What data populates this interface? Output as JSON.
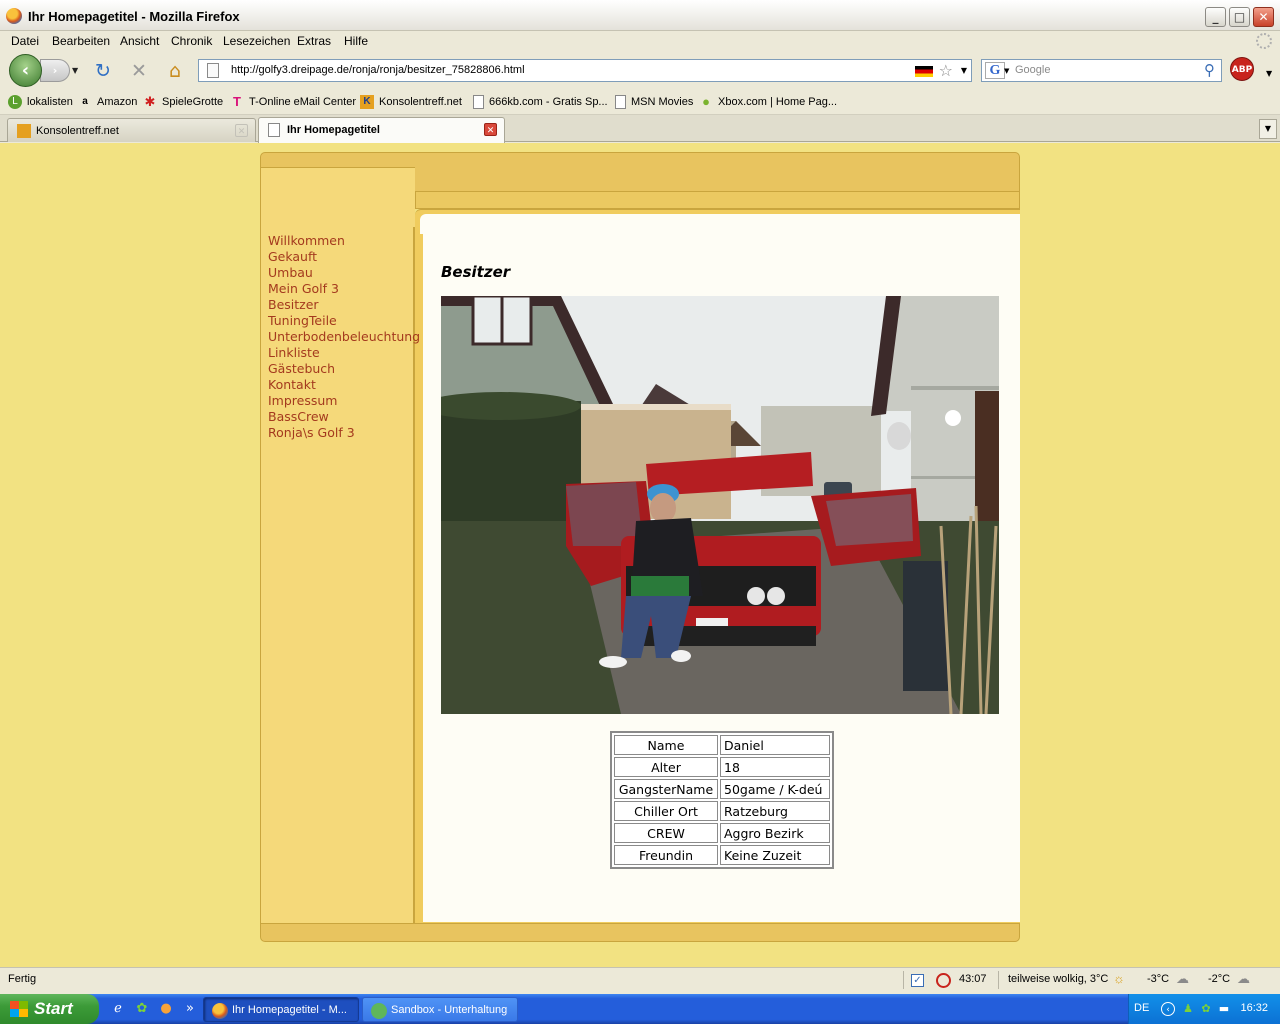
{
  "window": {
    "title": "Ihr Homepagetitel - Mozilla Firefox",
    "controls": {
      "minimize": "_",
      "maximize": "□",
      "close": "✕"
    }
  },
  "menu": {
    "items": [
      {
        "label": "Datei"
      },
      {
        "label": "Bearbeiten"
      },
      {
        "label": "Ansicht"
      },
      {
        "label": "Chronik"
      },
      {
        "label": "Lesezeichen"
      },
      {
        "label": "Extras"
      },
      {
        "label": "Hilfe"
      }
    ]
  },
  "navigation": {
    "url": "http://golfy3.dreipage.de/ronja/ronja/besitzer_75828806.html",
    "search_placeholder": "Google",
    "icons": [
      "back-arrow-icon",
      "forward-arrow-icon",
      "reload-icon",
      "stop-icon",
      "home-icon",
      "german-flag-icon",
      "bookmark-star-icon",
      "search-magnifier-icon",
      "adblock-plus-icon"
    ],
    "adblock_label": "ABP"
  },
  "bookmarks": {
    "items": [
      {
        "label": "lokalisten",
        "icon": "L"
      },
      {
        "label": "Amazon",
        "icon": "a"
      },
      {
        "label": "SpieleGrotte",
        "icon": "✱"
      },
      {
        "label": "T-Online eMail Center",
        "icon": "T"
      },
      {
        "label": "Konsolentreff.net",
        "icon": "K"
      },
      {
        "label": "666kb.com - Gratis Sp...",
        "icon": ""
      },
      {
        "label": "MSN Movies",
        "icon": ""
      },
      {
        "label": "Xbox.com | Home Pag...",
        "icon": "●"
      }
    ]
  },
  "tabs": [
    {
      "label": "Konsolentreff.net",
      "active": false
    },
    {
      "label": "Ihr Homepagetitel",
      "active": true
    }
  ],
  "site": {
    "nav_links": [
      {
        "label": "Willkommen"
      },
      {
        "label": "Gekauft"
      },
      {
        "label": "Umbau"
      },
      {
        "label": "Mein Golf 3"
      },
      {
        "label": "Besitzer"
      },
      {
        "label": "TuningTeile"
      },
      {
        "label": "Unterbodenbeleuchtung"
      },
      {
        "label": "Linkliste"
      },
      {
        "label": "Gästebuch"
      },
      {
        "label": "Kontakt"
      },
      {
        "label": "Impressum"
      },
      {
        "label": "BassCrew"
      },
      {
        "label": "Ronja\\s Golf 3"
      }
    ],
    "heading": "Besitzer",
    "info_rows": [
      {
        "key": "Name",
        "value": "Daniel"
      },
      {
        "key": "Alter",
        "value": "18"
      },
      {
        "key": "GangsterName",
        "value": "50game / K-deú"
      },
      {
        "key": "Chiller Ort",
        "value": "Ratzeburg"
      },
      {
        "key": "CREW",
        "value": "Aggro Bezirk"
      },
      {
        "key": "Freundin",
        "value": "Keine Zuzeit"
      }
    ]
  },
  "status": {
    "text": "Fertig",
    "timer": "43:07",
    "weather": "teilweise wolkig, 3°C",
    "temp1": "-3°C",
    "temp2": "-2°C"
  },
  "taskbar": {
    "start_label": "Start",
    "quicklaunch_more": "»",
    "buttons": [
      {
        "label": "Ihr Homepagetitel - M...",
        "active": true
      },
      {
        "label": "Sandbox - Unterhaltung",
        "active": false
      }
    ],
    "language": "DE",
    "clock": "16:32"
  }
}
